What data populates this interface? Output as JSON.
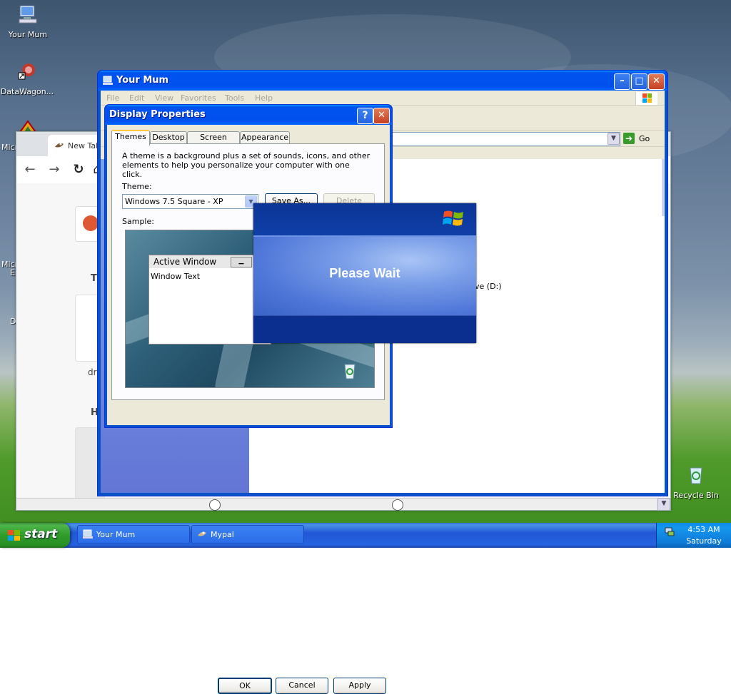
{
  "desktop": {
    "icons": [
      {
        "label": "Your Mum",
        "icon": "computer-icon"
      },
      {
        "label": "DataWagon...",
        "icon": "datawagon-icon"
      },
      {
        "label": "Recycle Bin",
        "icon": "recycle-bin-icon"
      }
    ],
    "partial_labels": [
      "Micr",
      "Micr",
      "E",
      "D"
    ]
  },
  "browser": {
    "tab_label": "New Tab",
    "fragments": {
      "t": "T",
      "driv": "driv",
      "h": "H"
    }
  },
  "explorer": {
    "title": "Your Mum",
    "menu": [
      "File",
      "Edit",
      "View",
      "Favorites",
      "Tools",
      "Help"
    ],
    "go_label": "Go",
    "drive_fragment": "ve (D:)"
  },
  "display_properties": {
    "title": "Display Properties",
    "tabs": [
      "Themes",
      "Desktop",
      "Screen Saver",
      "Appearance"
    ],
    "active_tab": "Themes",
    "description": "A theme is a background plus a set of sounds, icons, and other elements to help you personalize your computer with one click.",
    "theme_label": "Theme:",
    "theme_value": "Windows 7.5 Square - XP",
    "save_as_label": "Save As...",
    "delete_label": "Delete",
    "sample_label": "Sample:",
    "sample_window_title": "Active Window",
    "sample_window_text": "Window Text",
    "ok_label": "OK",
    "cancel_label": "Cancel",
    "apply_label": "Apply"
  },
  "please_wait": {
    "text": "Please Wait"
  },
  "taskbar": {
    "start_label": "start",
    "buttons": [
      {
        "label": "Your Mum",
        "icon": "computer-icon"
      },
      {
        "label": "Mypal",
        "icon": "mypal-icon"
      }
    ],
    "clock": "4:53 AM",
    "day": "Saturday"
  },
  "colors": {
    "xp_blue": "#0053ee",
    "start_green": "#2f9c2a",
    "dialog_bg": "#ece9d8"
  }
}
